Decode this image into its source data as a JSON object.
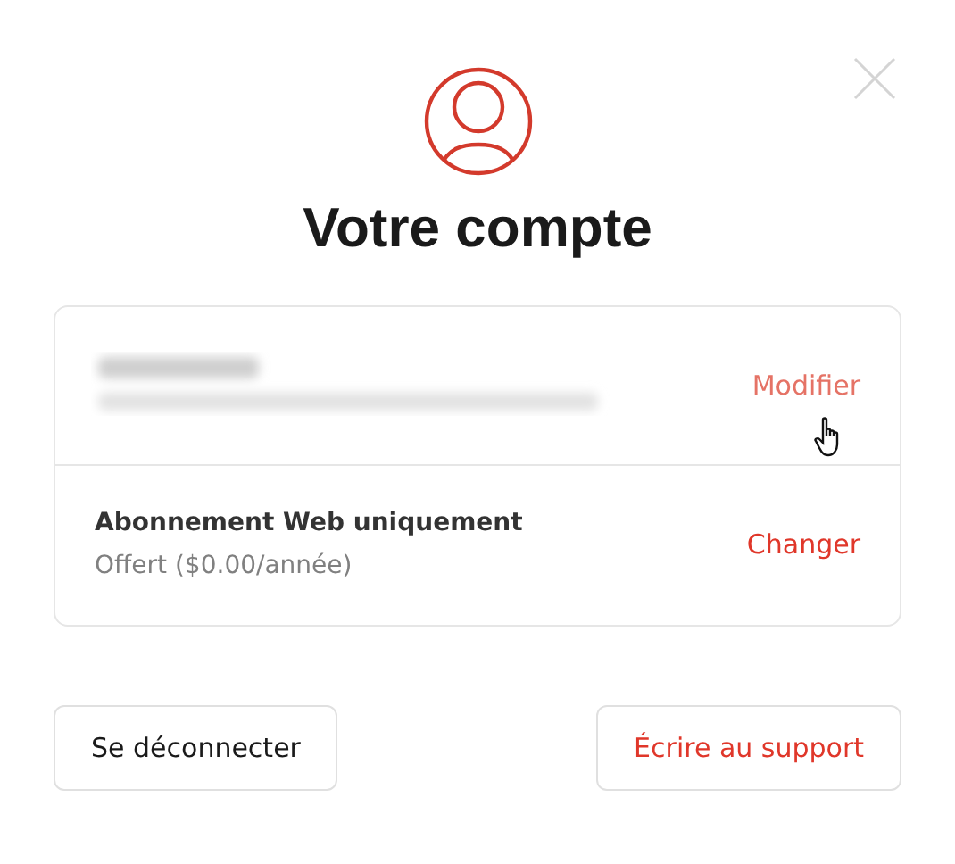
{
  "title": "Votre compte",
  "account": {
    "action": {
      "label": "Modifier",
      "hovered": true
    }
  },
  "subscription": {
    "name": "Abonnement Web uniquement",
    "price": "Offert ($0.00/année)",
    "action": {
      "label": "Changer",
      "hovered": false
    }
  },
  "buttons": [
    {
      "label": "Se déconnecter",
      "kind": "neutral"
    },
    {
      "label": "Écrire au support",
      "kind": "accent"
    }
  ]
}
